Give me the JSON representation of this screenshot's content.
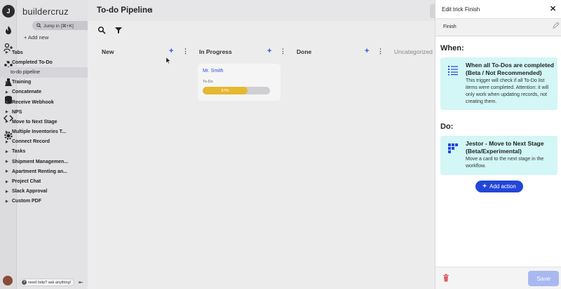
{
  "app": {
    "logo_letter": "J",
    "brand": "buildercruz"
  },
  "sidebar": {
    "jump_label": "Jump in [⌘+K]",
    "add_new": "+ Add new",
    "items": [
      {
        "label": "Tabs",
        "caret": "▶"
      },
      {
        "label": "Completed To-Do",
        "caret": "▼"
      },
      {
        "label": "to-do pipeline",
        "caret": ""
      },
      {
        "label": "Training",
        "caret": "▶"
      },
      {
        "label": "Concatenate",
        "caret": "▶"
      },
      {
        "label": "Receive Webhook",
        "caret": "▶"
      },
      {
        "label": "NPS",
        "caret": "▶"
      },
      {
        "label": "Move to Next Stage",
        "caret": "▶"
      },
      {
        "label": "Multiple Inventories T...",
        "caret": "▶"
      },
      {
        "label": "Connect Record",
        "caret": "▶"
      },
      {
        "label": "Tasks",
        "caret": "▶"
      },
      {
        "label": "Shipment Managemen...",
        "caret": "▶"
      },
      {
        "label": "Apartment Renting an...",
        "caret": "▶"
      },
      {
        "label": "Project Chat",
        "caret": "▶"
      },
      {
        "label": "Slack Approval",
        "caret": "▶"
      },
      {
        "label": "Custom PDF",
        "caret": "▶"
      }
    ],
    "help": "need help? ask anything!",
    "help_q": "?",
    "collapse": "⇤"
  },
  "main": {
    "title": "To-do Pipeline",
    "info": "i",
    "columns": [
      "New",
      "In Progress",
      "Done",
      "Uncategorized"
    ],
    "plus": "+",
    "kebab": "⋮",
    "card": {
      "name": "Mr. Smith",
      "label": "To-Do",
      "progress_text": "67%",
      "progress": 0.67
    }
  },
  "panel": {
    "title": "Edit trick Finish",
    "close": "✕",
    "name_value": "Finish",
    "when_label": "When:",
    "trigger_title": "When all To-Dos are completed (Beta / Not Recommended)",
    "trigger_desc": "This trigger will check if all To-Do list items were completed. Attention: it will only work when updating records, not creating them.",
    "do_label": "Do:",
    "action_title": "Jestor - Move to Next Stage (Beta/Experimental)",
    "action_desc": "Move a card to the next stage in the workflow.",
    "add_action_plus": "+",
    "add_action": "Add action",
    "save": "Save"
  },
  "colors": {
    "accent": "#2346d9",
    "progress": "#e6b830",
    "info_box": "#d3f6f7",
    "delete": "#e06060"
  }
}
